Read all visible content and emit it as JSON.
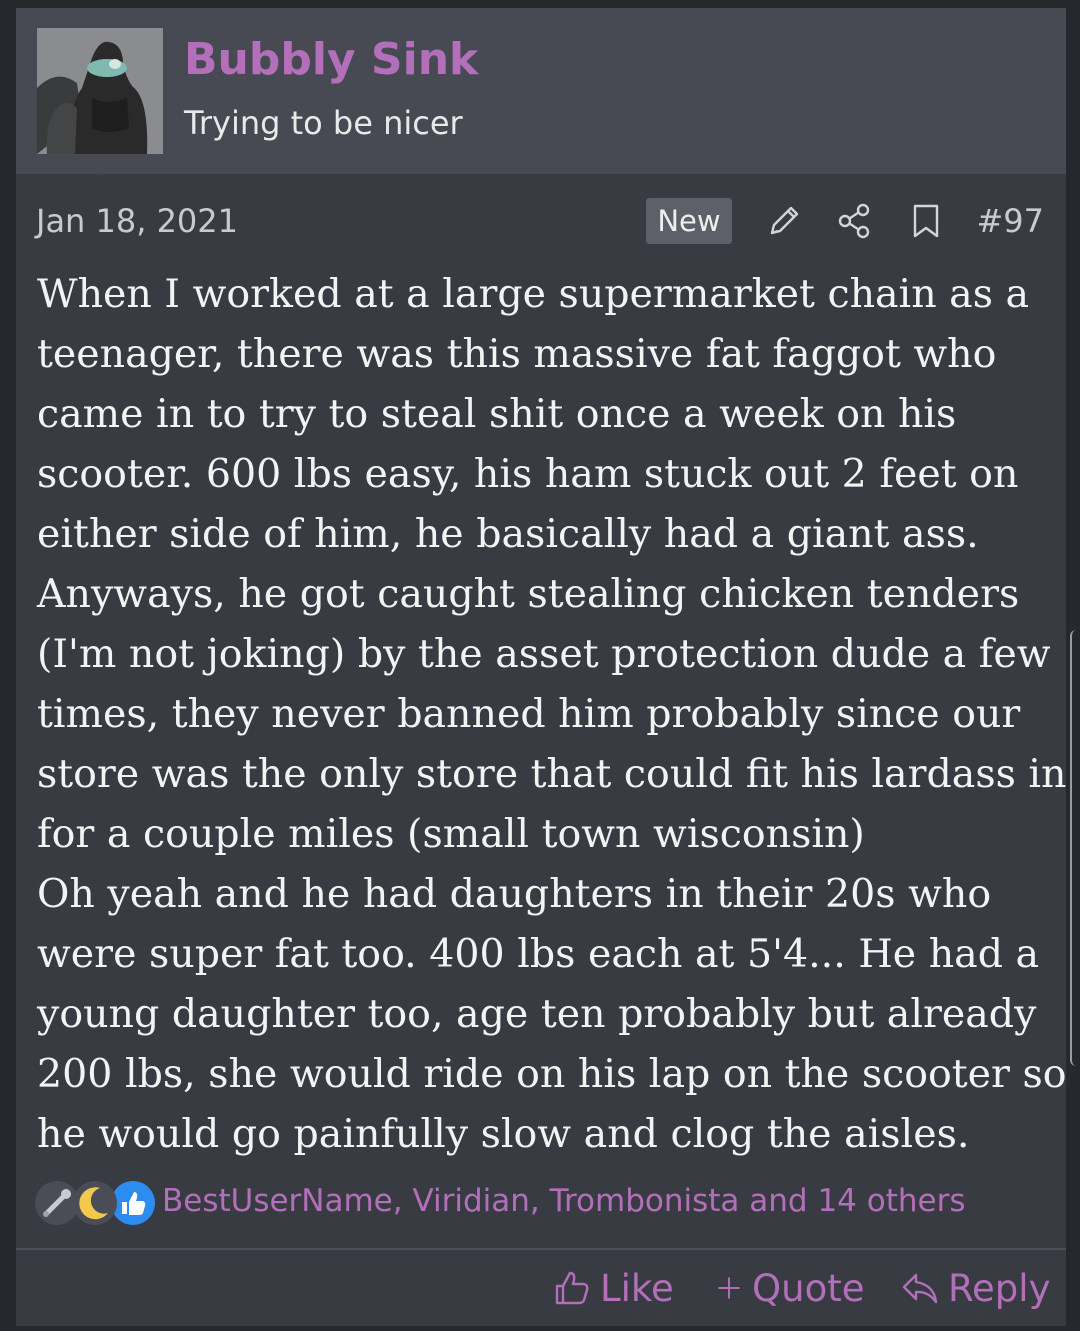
{
  "author": {
    "username": "Bubbly Sink",
    "user_title": "Trying to be nicer"
  },
  "meta": {
    "date": "Jan 18, 2021",
    "badge": "New",
    "post_number": "#97",
    "icons": [
      "pencil-icon",
      "share-icon",
      "bookmark-icon"
    ]
  },
  "body": {
    "lines": [
      "When I worked at a large supermarket chain as a",
      "teenager, there was this massive fat faggot who",
      "came in to try to steal shit once a week on his",
      "scooter. 600 lbs easy, his ham stuck out 2 feet on",
      "either side of him, he basically had a giant ass.",
      "Anyways, he got caught stealing chicken tenders",
      "(I'm not joking) by the asset protection dude a few",
      "times, they never banned him probably since our",
      "store was the only store that could fit his lardass in",
      "for a couple miles (small town wisconsin)",
      "Oh yeah and he had daughters in their 20s who",
      "were super fat too. 400 lbs each at 5'4... He had a",
      "young daughter too, age ten probably but already",
      "200 lbs, she would ride on his lap on the scooter so",
      "he would go painfully slow and clog the aisles."
    ]
  },
  "reactions": {
    "icons": [
      "wrench-icon",
      "crescent-moon-icon",
      "thumbs-up-icon"
    ],
    "list": "BestUserName, Viridian, Trombonista and 14 others"
  },
  "actions": {
    "like": "Like",
    "quote": "Quote",
    "reply": "Reply"
  },
  "colors": {
    "accent": "#b36fba",
    "background": "#383b42",
    "header": "#474a52"
  }
}
